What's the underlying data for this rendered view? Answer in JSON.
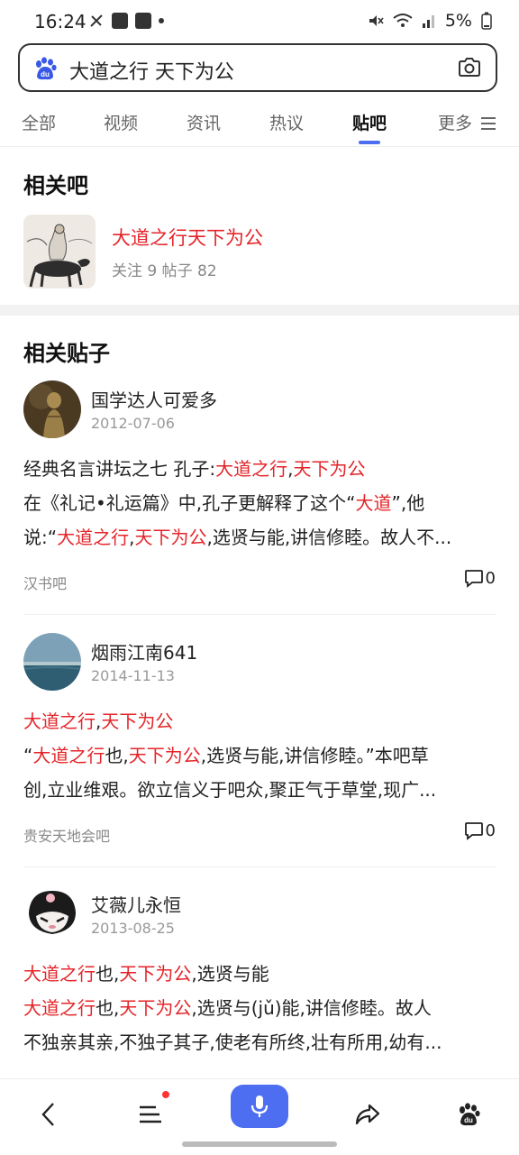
{
  "status": {
    "time": "16:24",
    "battery": "5%"
  },
  "search": {
    "query": "大道之行 天下为公"
  },
  "tabs": [
    {
      "label": "全部"
    },
    {
      "label": "视频"
    },
    {
      "label": "资讯"
    },
    {
      "label": "热议"
    },
    {
      "label": "贴吧"
    },
    {
      "label": "更多"
    }
  ],
  "colors": {
    "accent": "#4e6ef2",
    "highlight": "#e4252a"
  },
  "related_bar": {
    "title": "相关吧",
    "name": "大道之行天下为公",
    "stats": "关注 9  帖子 82"
  },
  "related_posts_title": "相关贴子",
  "posts": [
    {
      "author": "国学达人可爱多",
      "date": "2012-07-06",
      "lines": [
        [
          {
            "t": "经典名言讲坛之七 孔子:",
            "h": false
          },
          {
            "t": "大道之行",
            "h": true
          },
          {
            "t": ",",
            "h": false
          },
          {
            "t": "天下为公",
            "h": true
          }
        ],
        [
          {
            "t": "在《礼记•礼运篇》中,孔子更解释了这个“",
            "h": false
          },
          {
            "t": "大道",
            "h": true
          },
          {
            "t": "”,他",
            "h": false
          }
        ],
        [
          {
            "t": "说:“",
            "h": false
          },
          {
            "t": "大道之行",
            "h": true
          },
          {
            "t": ",",
            "h": false
          },
          {
            "t": "天下为公",
            "h": true
          },
          {
            "t": ",选贤与能,讲信修睦。故人不...",
            "h": false
          }
        ]
      ],
      "source": "汉书吧",
      "comments": "0"
    },
    {
      "author": "烟雨江南641",
      "date": "2014-11-13",
      "lines": [
        [
          {
            "t": "大道之行",
            "h": true
          },
          {
            "t": ",",
            "h": false
          },
          {
            "t": "天下为公",
            "h": true
          }
        ],
        [
          {
            "t": "“",
            "h": false
          },
          {
            "t": "大道之行",
            "h": true
          },
          {
            "t": "也,",
            "h": false
          },
          {
            "t": "天下为公",
            "h": true
          },
          {
            "t": ",选贤与能,讲信修睦。”本吧草",
            "h": false
          }
        ],
        [
          {
            "t": "创,立业维艰。欲立信义于吧众,聚正气于草堂,现广...",
            "h": false
          }
        ]
      ],
      "source": "贵安天地会吧",
      "comments": "0"
    },
    {
      "author": "艾薇儿永恒",
      "date": "2013-08-25",
      "lines": [
        [
          {
            "t": "大道之行",
            "h": true
          },
          {
            "t": "也,",
            "h": false
          },
          {
            "t": "天下为公",
            "h": true
          },
          {
            "t": ",选贤与能",
            "h": false
          }
        ],
        [
          {
            "t": "大道之行",
            "h": true
          },
          {
            "t": "也,",
            "h": false
          },
          {
            "t": "天下为公",
            "h": true
          },
          {
            "t": ",选贤与(jǔ)能,讲信修睦。故人",
            "h": false
          }
        ],
        [
          {
            "t": "不独亲其亲,不独子其子,使老有所终,壮有所用,幼有...",
            "h": false
          }
        ]
      ]
    }
  ],
  "icons": [
    "back-icon",
    "menu-icon",
    "mic-icon",
    "share-icon",
    "baidu-paw-icon",
    "camera-icon",
    "comment-icon"
  ]
}
